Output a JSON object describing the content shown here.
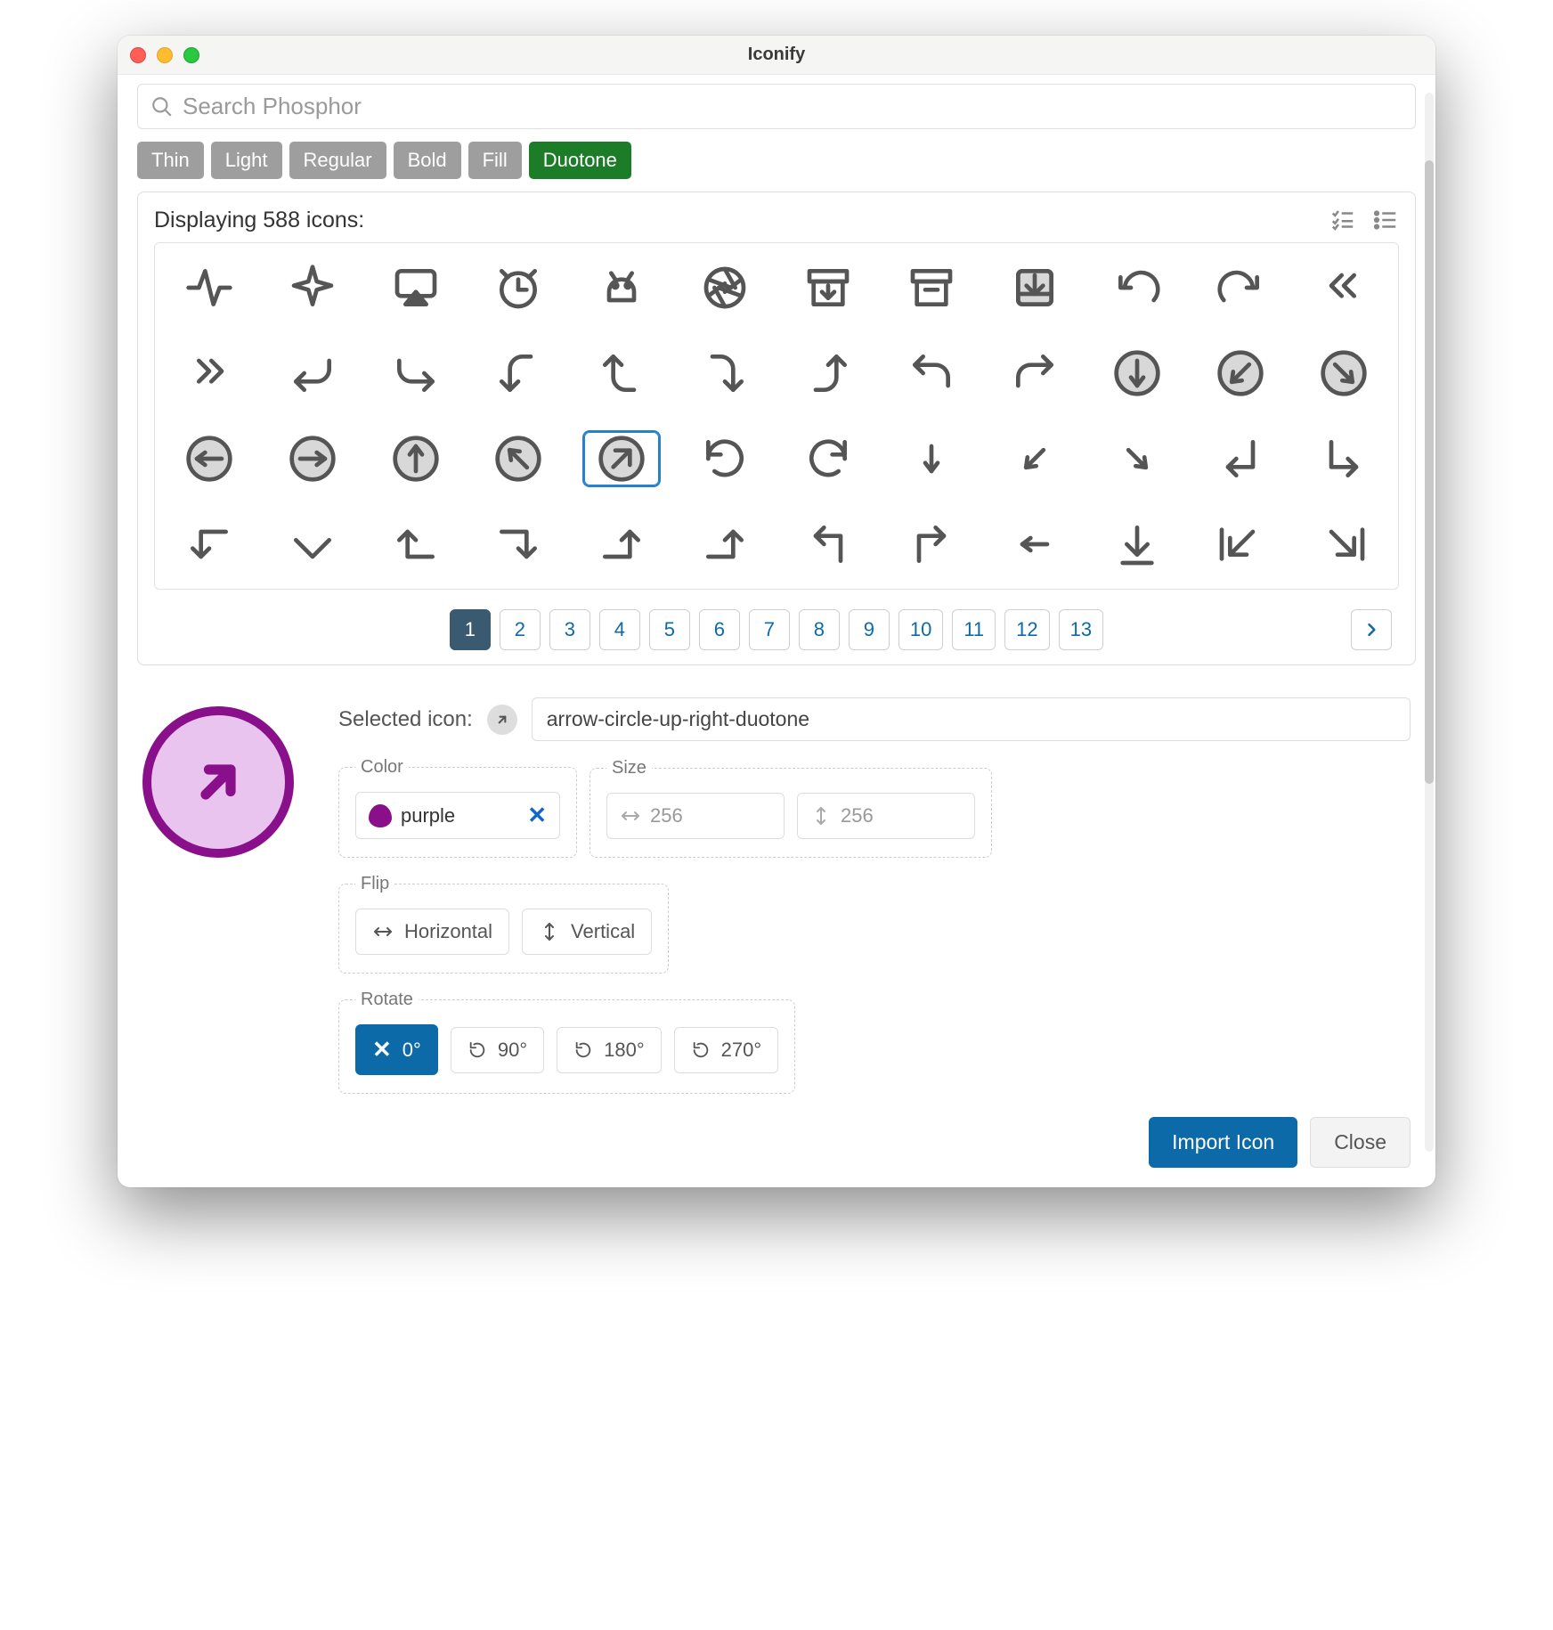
{
  "window": {
    "title": "Iconify"
  },
  "search": {
    "placeholder": "Search Phosphor"
  },
  "filters": [
    "Thin",
    "Light",
    "Regular",
    "Bold",
    "Fill",
    "Duotone"
  ],
  "filter_active": "Duotone",
  "panel": {
    "count_label": "Displaying 588 icons:"
  },
  "icons": [
    {
      "name": "activity"
    },
    {
      "name": "airplane"
    },
    {
      "name": "airplay"
    },
    {
      "name": "alarm"
    },
    {
      "name": "android-logo"
    },
    {
      "name": "aperture"
    },
    {
      "name": "archive-box"
    },
    {
      "name": "archive"
    },
    {
      "name": "archive-tray"
    },
    {
      "name": "arrow-arc-left"
    },
    {
      "name": "arrow-arc-right"
    },
    {
      "name": "arrow-bend-double-up-left"
    },
    {
      "name": "arrow-bend-double-up-right"
    },
    {
      "name": "arrow-bend-down-left"
    },
    {
      "name": "arrow-bend-down-right"
    },
    {
      "name": "arrow-bend-left-down"
    },
    {
      "name": "arrow-bend-left-up"
    },
    {
      "name": "arrow-bend-right-down"
    },
    {
      "name": "arrow-bend-right-up"
    },
    {
      "name": "arrow-bend-up-left"
    },
    {
      "name": "arrow-bend-up-right"
    },
    {
      "name": "arrow-circle-down"
    },
    {
      "name": "arrow-circle-down-left"
    },
    {
      "name": "arrow-circle-down-right"
    },
    {
      "name": "arrow-circle-left"
    },
    {
      "name": "arrow-circle-right"
    },
    {
      "name": "arrow-circle-up"
    },
    {
      "name": "arrow-circle-up-left"
    },
    {
      "name": "arrow-circle-up-right",
      "selected": true
    },
    {
      "name": "arrow-clockwise"
    },
    {
      "name": "arrow-counter-clockwise"
    },
    {
      "name": "arrow-down"
    },
    {
      "name": "arrow-down-left"
    },
    {
      "name": "arrow-down-right"
    },
    {
      "name": "arrow-elbow-down-left"
    },
    {
      "name": "arrow-elbow-down-right"
    },
    {
      "name": "arrow-elbow-left"
    },
    {
      "name": "arrow-elbow-left-down"
    },
    {
      "name": "arrow-elbow-left-up"
    },
    {
      "name": "arrow-elbow-right"
    },
    {
      "name": "arrow-elbow-right-down"
    },
    {
      "name": "arrow-elbow-right-up"
    },
    {
      "name": "arrow-elbow-up-left"
    },
    {
      "name": "arrow-elbow-up-right"
    },
    {
      "name": "arrow-left"
    },
    {
      "name": "arrow-line-down"
    },
    {
      "name": "arrow-line-down-left"
    },
    {
      "name": "arrow-line-down-right"
    }
  ],
  "pages": [
    "1",
    "2",
    "3",
    "4",
    "5",
    "6",
    "7",
    "8",
    "9",
    "10",
    "11",
    "12",
    "13"
  ],
  "page_active": "1",
  "selected": {
    "label": "Selected icon:",
    "name": "arrow-circle-up-right-duotone",
    "color_label": "Color",
    "color_value": "purple",
    "color_hex": "#8a0f8a",
    "size_label": "Size",
    "size_w_placeholder": "256",
    "size_h_placeholder": "256",
    "flip_label": "Flip",
    "flip_h": "Horizontal",
    "flip_v": "Vertical",
    "rotate_label": "Rotate",
    "rotate_options": [
      "0°",
      "90°",
      "180°",
      "270°"
    ],
    "rotate_active": "0°"
  },
  "footer": {
    "import": "Import Icon",
    "close": "Close"
  }
}
